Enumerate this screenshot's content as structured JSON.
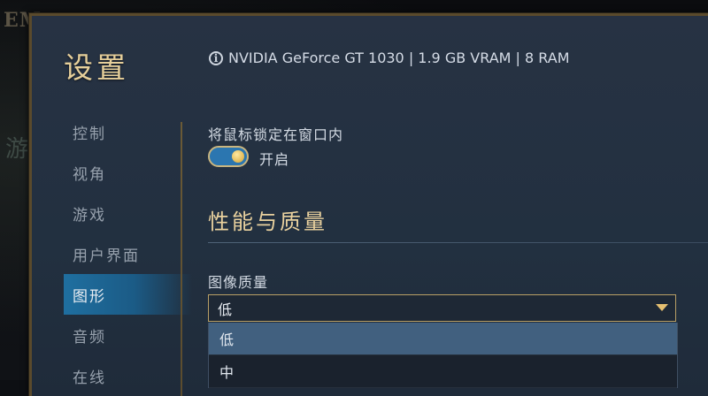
{
  "background": {
    "title_fragment": "EM",
    "side_fragment": "游"
  },
  "modal": {
    "title": "设置",
    "system_info": "NVIDIA GeForce GT 1030 | 1.9 GB VRAM | 8 RAM"
  },
  "nav": {
    "items": [
      {
        "label": "控制",
        "active": false
      },
      {
        "label": "视角",
        "active": false
      },
      {
        "label": "游戏",
        "active": false
      },
      {
        "label": "用户界面",
        "active": false
      },
      {
        "label": "图形",
        "active": true
      },
      {
        "label": "音频",
        "active": false
      },
      {
        "label": "在线",
        "active": false
      }
    ]
  },
  "mouse_lock": {
    "label": "将鼠标锁定在窗口内",
    "toggle_state_label": "开启",
    "enabled": true
  },
  "section": {
    "title": "性能与质量"
  },
  "image_quality": {
    "label": "图像质量",
    "selected": "低",
    "options": [
      "低",
      "中"
    ]
  },
  "colors": {
    "accent_gold": "#e6cf9a",
    "active_blue": "#1f6fa0",
    "panel_bg": "#273243"
  }
}
